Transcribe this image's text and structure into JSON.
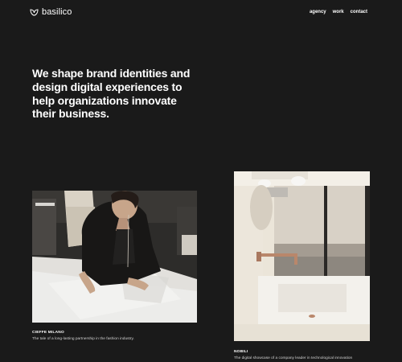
{
  "brand": {
    "name": "basilico"
  },
  "nav": {
    "items": [
      "agency",
      "work",
      "contact"
    ]
  },
  "hero": {
    "text": "We shape brand identities and design digital experiences to help organizations innovate their business."
  },
  "projects": [
    {
      "title": "CIEFFE MILANO",
      "description": "The tale of a long-lasting partnership in the fashion industry."
    },
    {
      "title": "NOBILI",
      "description": "The digital showcase of a company leader in technological innovation"
    }
  ],
  "colors": {
    "background": "#1a1a1a",
    "text": "#ffffff"
  }
}
